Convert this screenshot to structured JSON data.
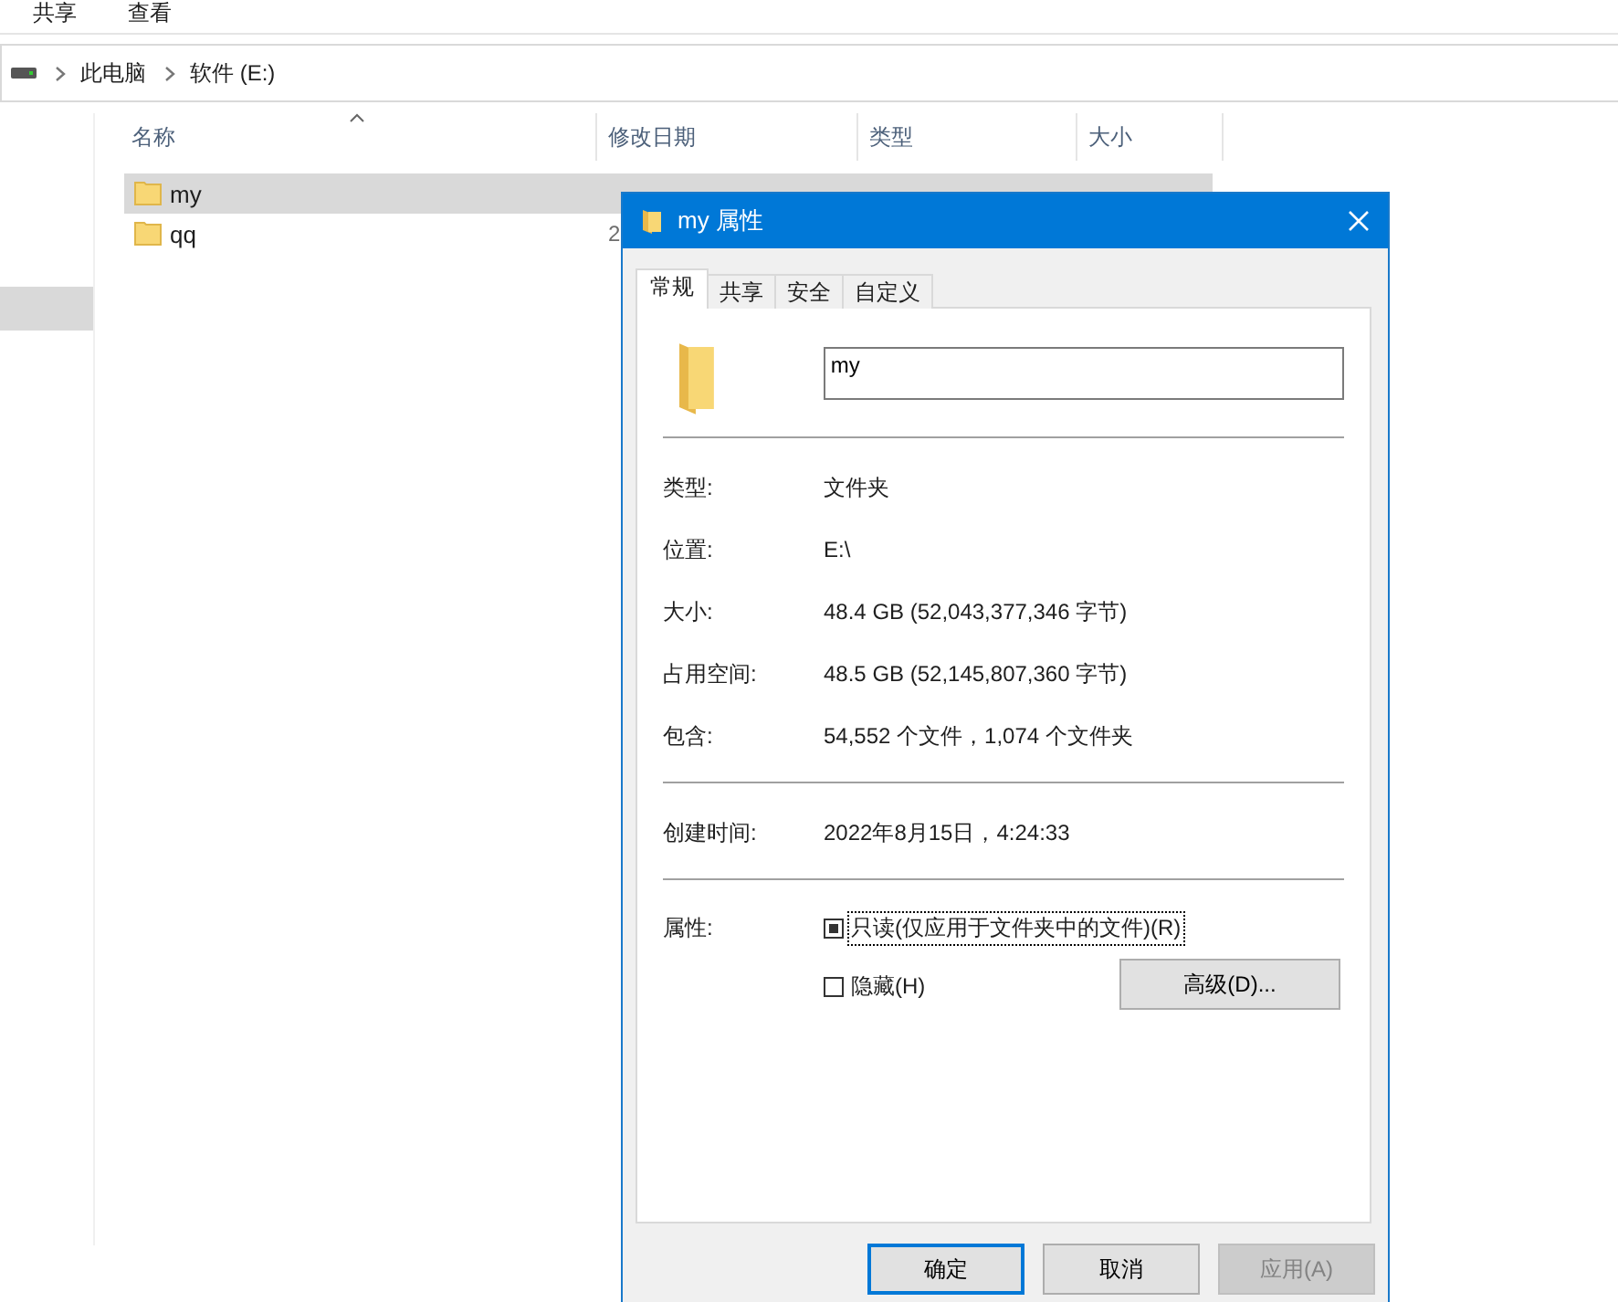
{
  "explorer": {
    "menu": [
      "共享",
      "查看"
    ],
    "breadcrumb": [
      "此电脑",
      "软件 (E:)"
    ],
    "columns": [
      "名称",
      "修改日期",
      "类型",
      "大小"
    ],
    "rows": [
      {
        "name": "my",
        "selected": true
      },
      {
        "name": "qq",
        "date": "2",
        "selected": false
      }
    ]
  },
  "dialog": {
    "title": "my 属性",
    "tabs": [
      {
        "label": "常规",
        "selected": true
      },
      {
        "label": "共享",
        "selected": false
      },
      {
        "label": "安全",
        "selected": false
      },
      {
        "label": "自定义",
        "selected": false
      }
    ],
    "name": "my",
    "sections": [
      [
        {
          "label": "类型:",
          "value": "文件夹"
        },
        {
          "label": "位置:",
          "value": "E:\\"
        },
        {
          "label": "大小:",
          "value": "48.4 GB (52,043,377,346 字节)"
        },
        {
          "label": "占用空间:",
          "value": "48.5 GB (52,145,807,360 字节)"
        },
        {
          "label": "包含:",
          "value": "54,552 个文件，1,074 个文件夹"
        }
      ],
      [
        {
          "label": "创建时间:",
          "value": "2022年8月15日，4:24:33"
        }
      ]
    ],
    "attributes_label": "属性:",
    "attributes": [
      {
        "label": "只读(仅应用于文件夹中的文件)(R)",
        "checked": true,
        "focused": true
      },
      {
        "label": "隐藏(H)",
        "checked": false,
        "focused": false
      }
    ],
    "advanced_button": "高级(D)...",
    "buttons": [
      {
        "label": "确定",
        "kind": "default"
      },
      {
        "label": "取消",
        "kind": "normal"
      },
      {
        "label": "应用(A)",
        "kind": "disabled"
      }
    ]
  }
}
